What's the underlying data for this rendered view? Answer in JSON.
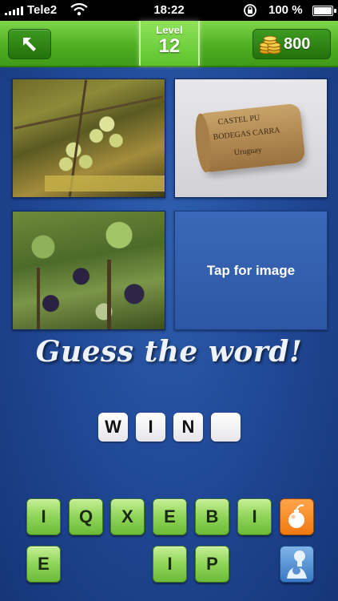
{
  "status_bar": {
    "carrier": "Tele2",
    "time": "18:22",
    "battery": "100 %"
  },
  "header": {
    "level_label": "Level",
    "level_number": "12",
    "coins": "800"
  },
  "puzzle": {
    "tap_label": "Tap for image",
    "heading": "Guess the word!",
    "answer_slots": [
      "W",
      "I",
      "N",
      ""
    ]
  },
  "cork_text": {
    "line1": "CASTEL PU",
    "line2": "BODEGAS CARRA",
    "line3": "Uruguay"
  },
  "keyboard": {
    "row1": [
      "I",
      "Q",
      "X",
      "E",
      "B",
      "I"
    ],
    "row2": [
      "E",
      "",
      "",
      "I",
      "P"
    ]
  },
  "colors": {
    "topbar_green": "#4fae22",
    "background_blue": "#214a98",
    "key_green": "#8fd458",
    "hint_orange": "#ef7a10"
  },
  "icons": {
    "back": "back-arrow-icon",
    "coins": "coin-stack-icon",
    "hint": "bomb-icon",
    "share": "silhouette-icon"
  }
}
